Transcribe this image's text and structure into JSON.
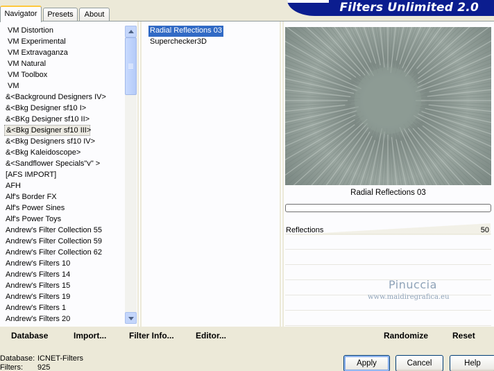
{
  "tabs": {
    "navigator": "Navigator",
    "presets": "Presets",
    "about": "About"
  },
  "banner": {
    "title": "Filters Unlimited 2.0"
  },
  "categories": [
    "VM Distortion",
    "VM Experimental",
    "VM Extravaganza",
    "VM Natural",
    "VM Toolbox",
    "VM",
    "&<Background Designers IV>",
    "&<Bkg Designer sf10 I>",
    "&<BKg Designer sf10 II>",
    "&<Bkg Designer sf10 III>",
    "&<Bkg Designers sf10 IV>",
    "&<Bkg Kaleidoscope>",
    "&<Sandflower Specials\"v\" >",
    "[AFS IMPORT]",
    "AFH",
    "Alf's Border FX",
    "Alf's Power Sines",
    "Alf's Power Toys",
    "Andrew's Filter Collection 55",
    "Andrew's Filter Collection 59",
    "Andrew's Filter Collection 62",
    "Andrew's Filters 10",
    "Andrew's Filters 14",
    "Andrew's Filters 15",
    "Andrew's Filters 19",
    "Andrew's Filters 1",
    "Andrew's Filters 20"
  ],
  "selected_category_index": 9,
  "filters": [
    "Radial Reflections 03",
    "Superchecker3D"
  ],
  "selected_filter_index": 0,
  "preview": {
    "filter_name": "Radial Reflections 03"
  },
  "params": [
    {
      "name": "Reflections",
      "value": "50"
    }
  ],
  "watermark": {
    "line1": "Pinuccia",
    "line2": "www.maidiregrafica.eu"
  },
  "toolbar": {
    "database": "Database",
    "import": "Import...",
    "filter_info": "Filter Info...",
    "editor": "Editor...",
    "randomize": "Randomize",
    "reset": "Reset"
  },
  "status": {
    "database_label": "Database:",
    "database_value": "ICNET-Filters",
    "filters_label": "Filters:",
    "filters_value": "925"
  },
  "buttons": {
    "apply": "Apply",
    "cancel": "Cancel",
    "help": "Help"
  },
  "colors": {
    "selection": "#316ac5",
    "banner": "#0b1d8f",
    "face": "#ece9d8"
  }
}
